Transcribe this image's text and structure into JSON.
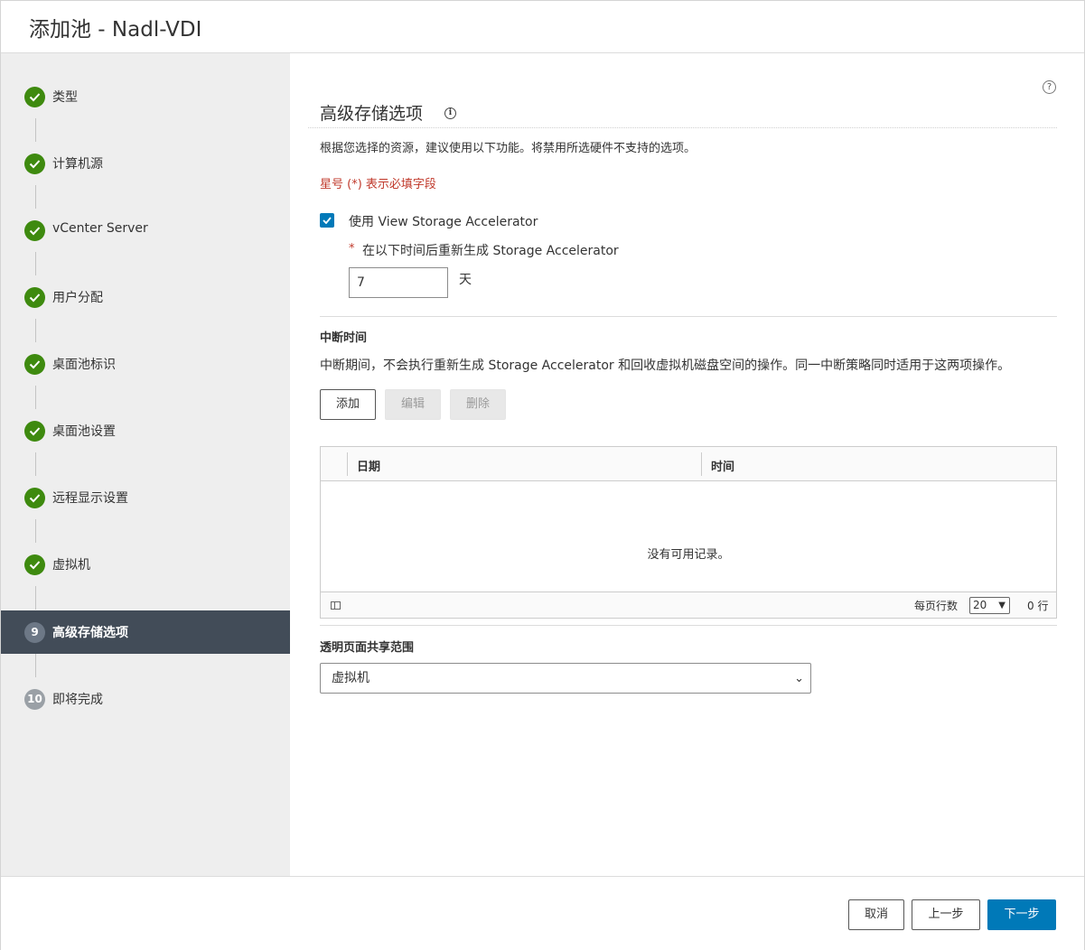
{
  "header": {
    "title": "添加池 - Nadl-VDI"
  },
  "sidebar": {
    "steps": [
      {
        "label": "类型",
        "state": "done"
      },
      {
        "label": "计算机源",
        "state": "done"
      },
      {
        "label": "vCenter Server",
        "state": "done"
      },
      {
        "label": "用户分配",
        "state": "done"
      },
      {
        "label": "桌面池标识",
        "state": "done"
      },
      {
        "label": "桌面池设置",
        "state": "done"
      },
      {
        "label": "远程显示设置",
        "state": "done"
      },
      {
        "label": "虚拟机",
        "state": "done"
      },
      {
        "label": "高级存储选项",
        "state": "active",
        "number": "9"
      },
      {
        "label": "即将完成",
        "state": "todo",
        "number": "10"
      }
    ]
  },
  "main": {
    "help_icon": "?",
    "title": "高级存储选项",
    "info_icon": "i",
    "description": "根据您选择的资源，建议使用以下功能。将禁用所选硬件不支持的选项。",
    "required_note": "星号 (*) 表示必填字段",
    "storage_accelerator": {
      "checked": true,
      "label": "使用 View Storage Accelerator",
      "required_star": "*",
      "regen_label": "在以下时间后重新生成 Storage Accelerator",
      "days_value": "7",
      "days_unit": "天"
    },
    "blackout": {
      "title": "中断时间",
      "description": "中断期间，不会执行重新生成 Storage Accelerator 和回收虚拟机磁盘空间的操作。同一中断策略同时适用于这两项操作。",
      "add_label": "添加",
      "edit_label": "编辑",
      "delete_label": "删除",
      "grid": {
        "columns": [
          "日期",
          "时间"
        ],
        "empty_text": "没有可用记录。",
        "per_page_label": "每页行数",
        "per_page_value": "20",
        "row_count": "0 行"
      }
    },
    "tps": {
      "title": "透明页面共享范围",
      "selected": "虚拟机"
    }
  },
  "footer": {
    "cancel_label": "取消",
    "prev_label": "上一步",
    "next_label": "下一步"
  },
  "colors": {
    "step_done": "#3e8a0f",
    "step_active_bg": "#424c58",
    "primary": "#0079b8",
    "required": "#c0392b"
  }
}
